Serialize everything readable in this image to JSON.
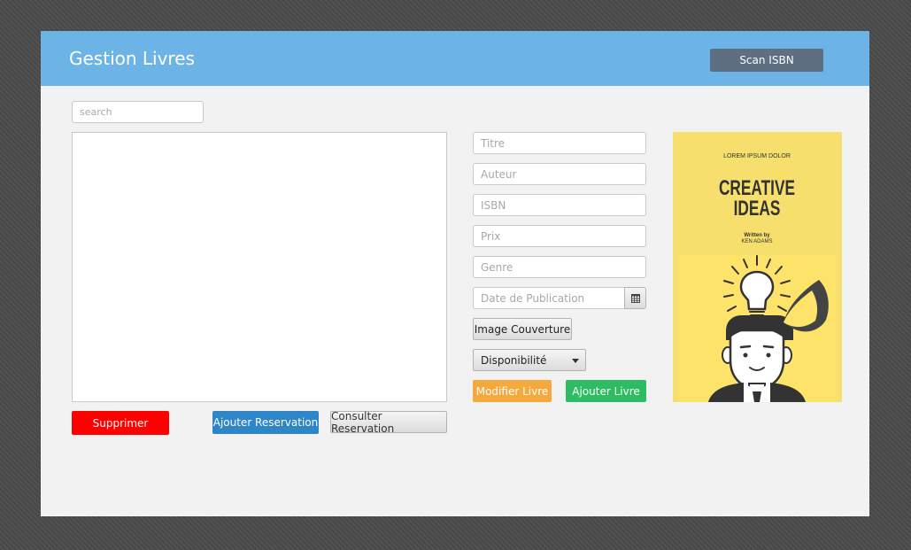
{
  "header": {
    "title": "Gestion Livres",
    "scan_button": "Scan ISBN"
  },
  "search": {
    "placeholder": "search",
    "value": ""
  },
  "list": {
    "items": []
  },
  "actions": {
    "delete": "Supprimer",
    "add_reservation": "Ajouter Reservation",
    "view_reservation": "Consulter Reservation"
  },
  "form": {
    "titre_placeholder": "Titre",
    "auteur_placeholder": "Auteur",
    "isbn_placeholder": "ISBN",
    "prix_placeholder": "Prix",
    "genre_placeholder": "Genre",
    "date_placeholder": "Date de Publication",
    "date_icon": "calendar-icon",
    "image_button": "Image Couverture",
    "disponibilite": "Disponibilité",
    "modify_button": "Modifier Livre",
    "add_button": "Ajouter Livre"
  },
  "cover": {
    "top_text": "LOREM IPSUM DOLOR",
    "title_line1": "CREATIVE",
    "title_line2": "IDEAS",
    "written_by": "Written by",
    "author": "KEN ADAMS"
  },
  "colors": {
    "header": "#6cb4e6",
    "scan_button": "#5d6f80",
    "delete": "#ff0000",
    "add_reservation": "#2e86c9",
    "modify": "#f5a93d",
    "add_book": "#2ebc63",
    "cover_bg": "#f6df6c"
  }
}
